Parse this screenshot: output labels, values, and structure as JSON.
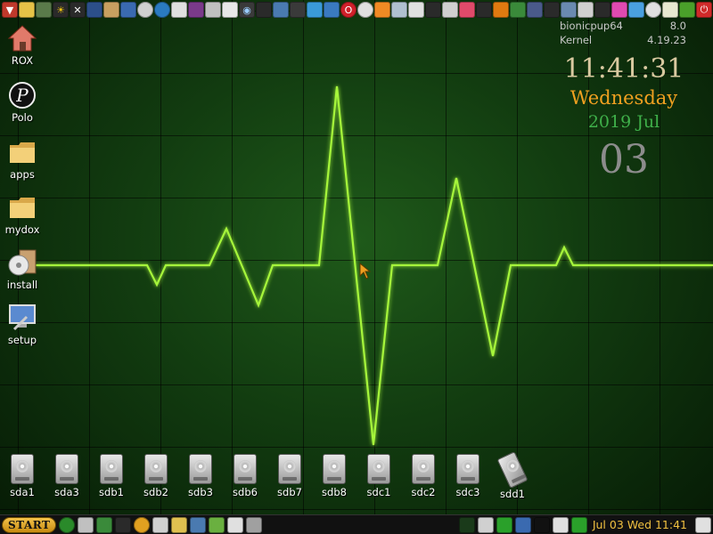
{
  "desktop": {
    "icons": [
      {
        "label": "ROX",
        "icon": "home-icon"
      },
      {
        "label": "Polo",
        "icon": "polo-icon"
      },
      {
        "label": "apps",
        "icon": "folder-icon"
      },
      {
        "label": "mydox",
        "icon": "folder-icon"
      },
      {
        "label": "install",
        "icon": "install-disc-icon"
      },
      {
        "label": "setup",
        "icon": "monitor-setup-icon"
      }
    ]
  },
  "sysinfo": {
    "distro_label": "bionicpup64",
    "distro_value": "8.0",
    "kernel_label": "Kernel",
    "kernel_value": "4.19.23"
  },
  "clock": {
    "time": "11:41:31",
    "day": "Wednesday",
    "month": "2019 Jul",
    "date": "03"
  },
  "drives": [
    {
      "label": "sda1"
    },
    {
      "label": "sda3"
    },
    {
      "label": "sdb1"
    },
    {
      "label": "sdb2"
    },
    {
      "label": "sdb3"
    },
    {
      "label": "sdb6"
    },
    {
      "label": "sdb7"
    },
    {
      "label": "sdb8"
    },
    {
      "label": "sdc1"
    },
    {
      "label": "sdc2"
    },
    {
      "label": "sdc3"
    },
    {
      "label": "sdd1"
    }
  ],
  "taskbar": {
    "start_label": "START",
    "clock": "Jul 03 Wed 11:41"
  },
  "colors": {
    "ecg_trace": "#a6f63a",
    "clock_time": "#d9c9a0",
    "clock_day": "#f0a020",
    "clock_month": "#3fb04a",
    "taskbar_clock": "#f0c040"
  }
}
